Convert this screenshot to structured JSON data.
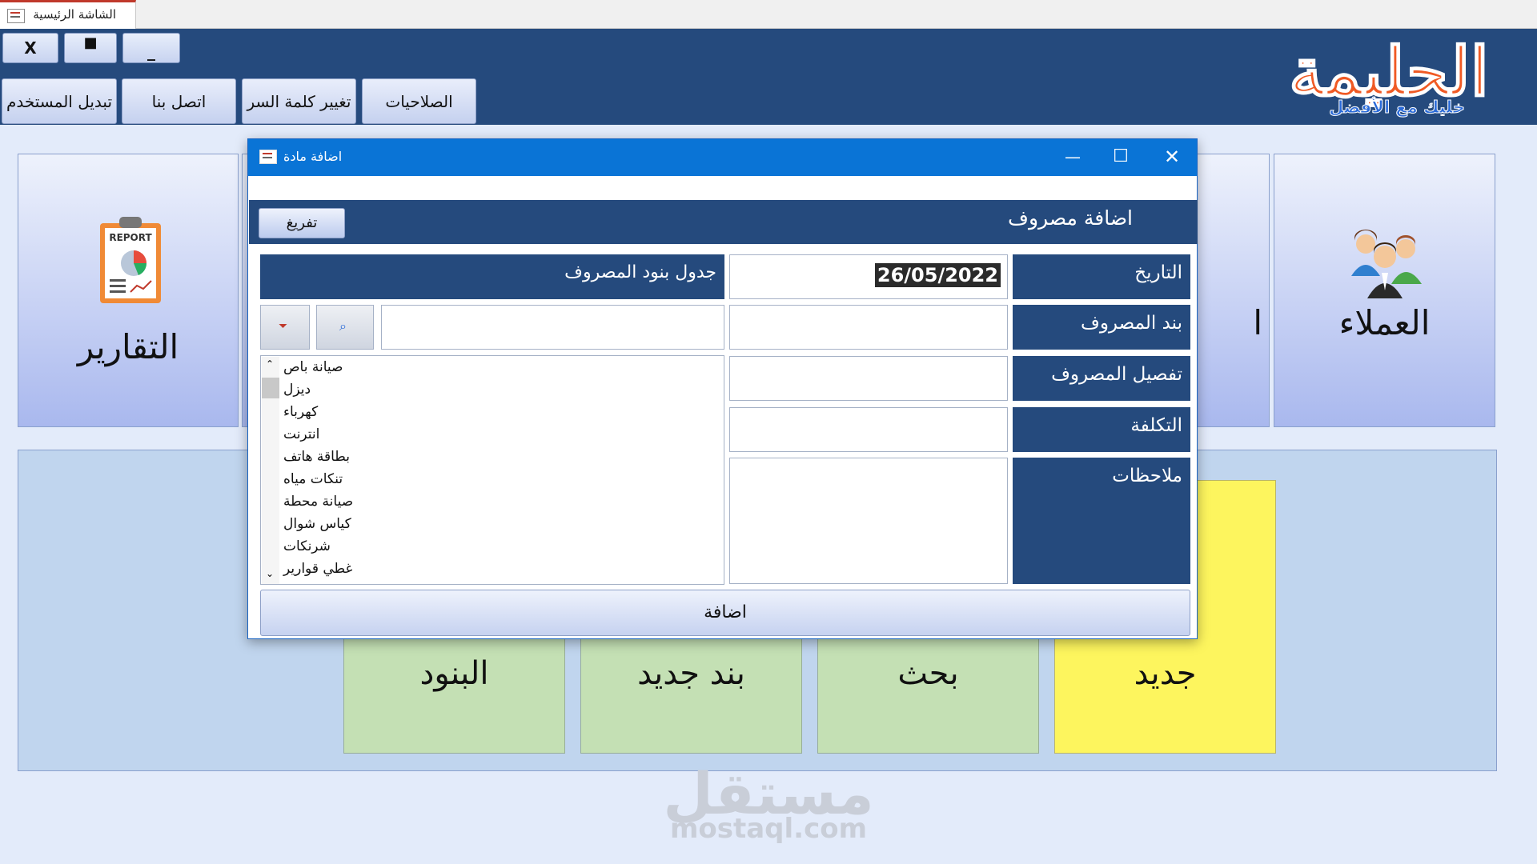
{
  "tabs": {
    "main_tab": "الشاشة الرئيسية"
  },
  "window_controls": {
    "close": "X",
    "maximize": "■",
    "minimize": "_"
  },
  "toolbar": {
    "switch_user": "تبديل المستخدم",
    "contact_us": "اتصل بنا",
    "change_password": "تغيير كلمة السر",
    "permissions": "الصلاحيات"
  },
  "logo": {
    "brand": "الحليمة",
    "slogan": "خليك مع الأفضل"
  },
  "tiles": {
    "reports": "التقارير",
    "customers": "العملاء",
    "partial_label": "ا"
  },
  "bottom_tiles": {
    "items": "البنود",
    "new_item": "بند جديد",
    "search": "بحث",
    "new": "جديد"
  },
  "watermark": {
    "arabic": "مستقل",
    "latin": "mostaql.com"
  },
  "dialog": {
    "title": "اضافة مادة",
    "heading": "اضافة مصروف",
    "clear_button": "تفريغ",
    "expense_table_header": "جدول بنود المصروف",
    "labels": {
      "date": "التاريخ",
      "expense_item": "بند المصروف",
      "expense_detail": "تفصيل المصروف",
      "cost": "التكلفة",
      "notes": "ملاحظات"
    },
    "values": {
      "date": "26/05/2022",
      "expense_item": "",
      "expense_detail": "",
      "cost": "",
      "notes": "",
      "search": ""
    },
    "list_items": [
      "صيانة باص",
      "ديزل",
      "كهرباء",
      "انترنت",
      "بطاقة هاتف",
      "تنكات مياه",
      "صيانة محطة",
      "كياس شوال",
      "شرنكات",
      "غطي قوارير"
    ],
    "add_button": "اضافة"
  },
  "colors": {
    "header_navy": "#254a7d",
    "title_blue": "#0a74d6",
    "tile_green": "#c4e0b4",
    "tile_yellow": "#fdf55e",
    "logo_orange": "#f05a24"
  }
}
